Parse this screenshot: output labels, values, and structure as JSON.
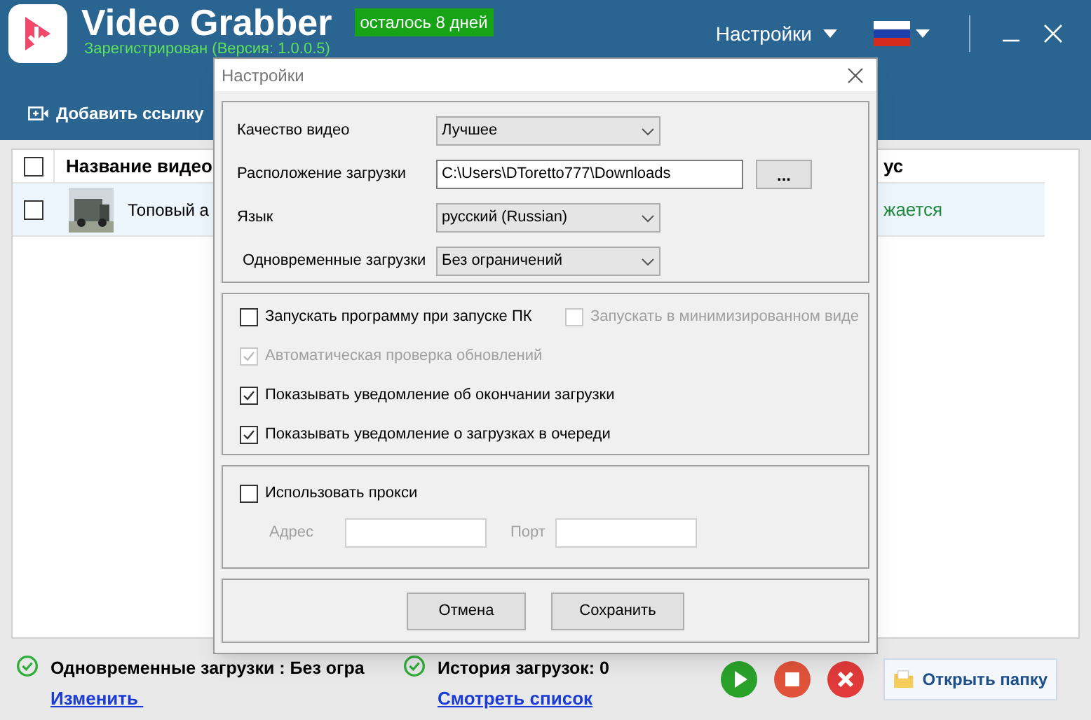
{
  "app": {
    "title": "Video Grabber",
    "trial_badge": "осталось 8 дней",
    "registration": "Зарегистрирован (Версия: 1.0.0.5)",
    "settings_menu": "Настройки"
  },
  "toolbar": {
    "add_link": "Добавить ссылку"
  },
  "table": {
    "header_checked": false,
    "columns": [
      {
        "label": "Название видео"
      },
      {
        "label": "ус"
      }
    ],
    "rows": [
      {
        "checked": false,
        "title": "Топовый а",
        "status": "жается"
      }
    ]
  },
  "footer": {
    "items": [
      {
        "text": "Одновременные загрузки : Без огра",
        "link": "Изменить "
      },
      {
        "text": "История загрузок: 0",
        "link": "Смотреть список"
      }
    ],
    "open_folder": "Открыть папку"
  },
  "dialog": {
    "title": "Настройки",
    "fields": [
      {
        "kind": "select",
        "label": "Качество видео",
        "value": "Лучшее"
      },
      {
        "kind": "path",
        "label": "Расположение загрузки",
        "value": "C:\\Users\\DToretto777\\Downloads",
        "browse": "..."
      },
      {
        "kind": "select",
        "label": "Язык",
        "value": "русский (Russian)"
      },
      {
        "kind": "select",
        "label": "Одновременные загрузки",
        "value": "Без ограничений"
      }
    ],
    "options": [
      {
        "label": "Запускать программу при запуске ПК",
        "checked": false,
        "disabled": false
      },
      {
        "label": "Запускать в минимизированном виде",
        "checked": false,
        "disabled": true
      },
      {
        "label": "Автоматическая проверка обновлений",
        "checked": true,
        "disabled": true
      },
      {
        "label": "Показывать уведомление об окончании загрузки",
        "checked": true,
        "disabled": false
      },
      {
        "label": "Показывать уведомление о загрузках в очереди",
        "checked": true,
        "disabled": false
      }
    ],
    "proxy": {
      "label": "Использовать прокси",
      "checked": false,
      "address_label": "Адрес",
      "port_label": "Порт"
    },
    "buttons": [
      "Отмена",
      "Сохранить"
    ]
  }
}
